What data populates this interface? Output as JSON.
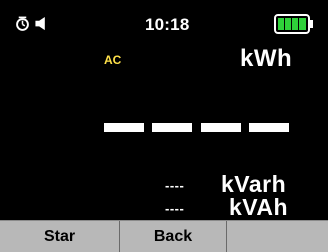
{
  "status": {
    "time": "10:18",
    "icons": [
      "clock-icon",
      "speaker-icon",
      "battery-icon"
    ],
    "battery_level": 1.0,
    "battery_color": "#2fd13a"
  },
  "display": {
    "mode": "AC",
    "mode_color": "#ffe14a",
    "main_unit": "kWh",
    "main_value": "-----",
    "reactive_value": "----",
    "reactive_unit": "kVarh",
    "apparent_value": "----",
    "apparent_unit": "kVAh"
  },
  "softkeys": [
    {
      "label": "Star"
    },
    {
      "label": "Back"
    },
    {
      "label": ""
    }
  ]
}
